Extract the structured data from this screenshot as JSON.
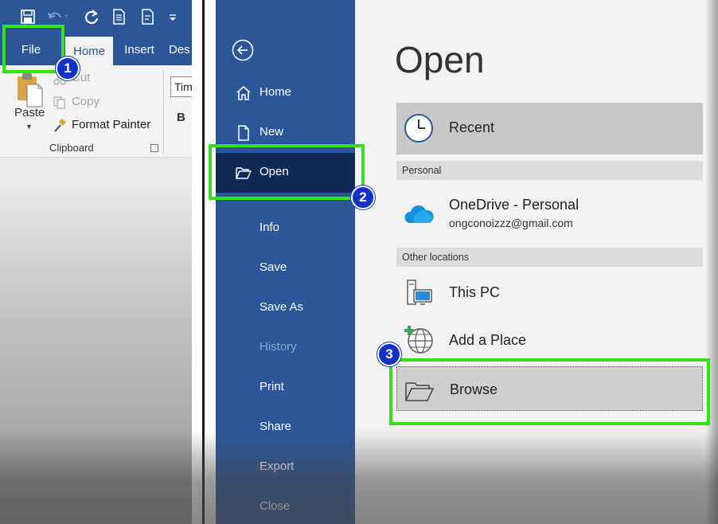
{
  "ribbon": {
    "tabs": {
      "file": "File",
      "home": "Home",
      "insert": "Insert",
      "design": "Des"
    },
    "clipboard": {
      "paste": "Paste",
      "cut": "Cut",
      "copy": "Copy",
      "format_painter": "Format Painter",
      "group_label": "Clipboard"
    },
    "font_name": "Tim",
    "bold": "B"
  },
  "backstage": {
    "nav": {
      "home": "Home",
      "new": "New",
      "open": "Open",
      "info": "Info",
      "save": "Save",
      "save_as": "Save As",
      "history": "History",
      "print": "Print",
      "share": "Share",
      "export": "Export",
      "close": "Close"
    },
    "open_pane": {
      "title": "Open",
      "recent": "Recent",
      "personal_header": "Personal",
      "onedrive_label": "OneDrive - Personal",
      "onedrive_account": "ongconoizzz@gmail.com",
      "other_header": "Other locations",
      "this_pc": "This PC",
      "add_place": "Add a Place",
      "browse": "Browse"
    }
  },
  "annotations": {
    "step1": "1",
    "step2": "2",
    "step3": "3",
    "highlight_color": "#38e01c",
    "badge_color": "#1233c6"
  },
  "colors": {
    "word_blue": "#2b579a",
    "selected_nav": "#0f2a57"
  }
}
